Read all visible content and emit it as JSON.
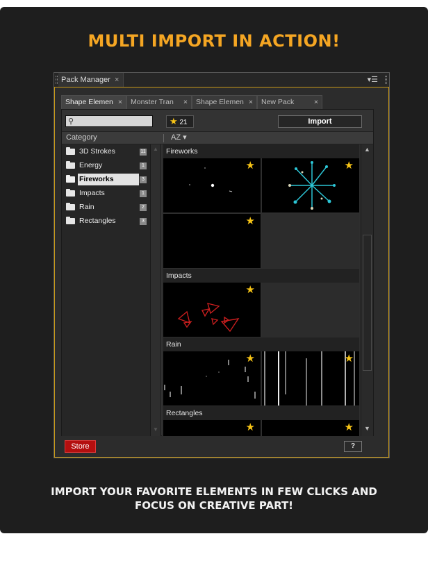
{
  "headline": "MULTI IMPORT IN ACTION!",
  "footer": {
    "line1": "IMPORT YOUR FAVORITE ELEMENTS IN FEW CLICKS AND",
    "line2": "FOCUS ON CREATIVE PART!"
  },
  "panel": {
    "title": "Pack Manager",
    "close_glyph": "×",
    "menu_glyph": "▾☰"
  },
  "tabs": [
    {
      "label": "Shape Elemen",
      "active": true,
      "close": "×"
    },
    {
      "label": "Monster Tran",
      "active": false,
      "close": "×"
    },
    {
      "label": "Shape Elemen",
      "active": false,
      "close": "×"
    },
    {
      "label": "New Pack",
      "active": false,
      "close": "×"
    }
  ],
  "toolbar": {
    "search_value": "",
    "search_icon": "magnifier-icon",
    "favorites_count": "21",
    "star_glyph": "★",
    "import_label": "Import"
  },
  "columns": {
    "category": "Category",
    "sort": "AZ ▾"
  },
  "categories": [
    {
      "name": "3D Strokes",
      "count": "11",
      "selected": false
    },
    {
      "name": "Energy",
      "count": "1",
      "selected": false
    },
    {
      "name": "Fireworks",
      "count": "3",
      "selected": true
    },
    {
      "name": "Impacts",
      "count": "1",
      "selected": false
    },
    {
      "name": "Rain",
      "count": "2",
      "selected": false
    },
    {
      "name": "Rectangles",
      "count": "3",
      "selected": false
    }
  ],
  "sections": {
    "fireworks": "Fireworks",
    "impacts": "Impacts",
    "rain": "Rain",
    "rectangles": "Rectangles"
  },
  "colors": {
    "accent": "#f5a623",
    "star": "#f7c416",
    "store": "#b40f0f",
    "firework_cyan": "#2cc6d6",
    "impact_red": "#c81e1e"
  },
  "bottom": {
    "store_label": "Store",
    "help_label": "?"
  },
  "scroll": {
    "up": "▲",
    "down": "▼"
  }
}
